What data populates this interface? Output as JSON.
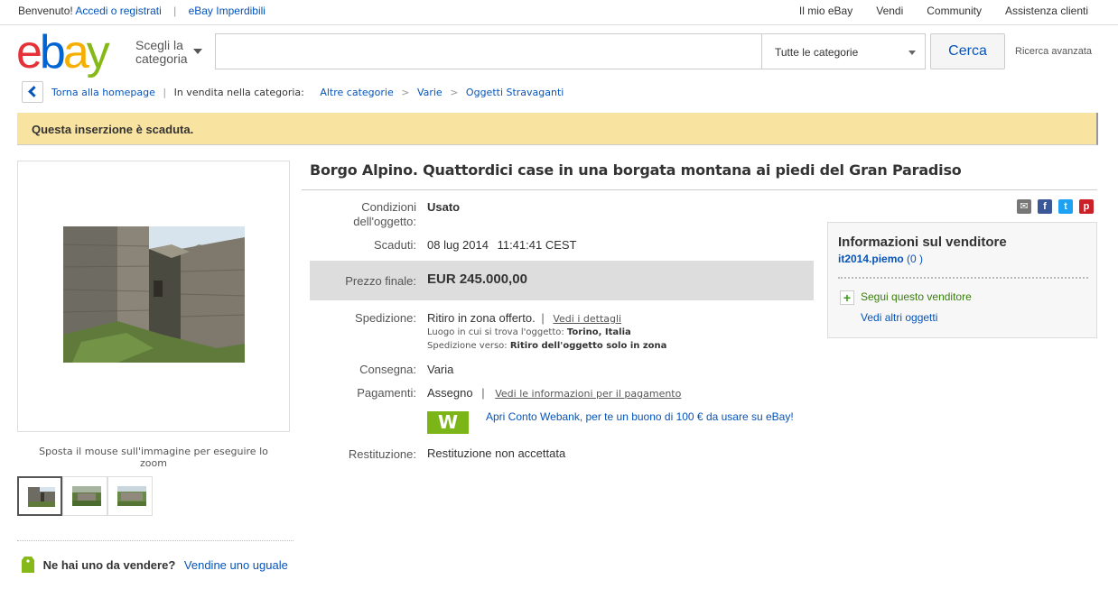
{
  "topbar": {
    "welcome": "Benvenuto!",
    "signin": "Accedi o registrati",
    "deals": "eBay Imperdibili",
    "right_links": [
      "Il mio eBay",
      "Vendi",
      "Community",
      "Assistenza clienti"
    ]
  },
  "header": {
    "logo": [
      "e",
      "b",
      "a",
      "y"
    ],
    "shop_by_line1": "Scegli la",
    "shop_by_line2": "categoria",
    "search_placeholder": "",
    "category_select": "Tutte le categorie",
    "search_button": "Cerca",
    "advanced": "Ricerca avanzata"
  },
  "breadcrumb": {
    "back": "Torna alla homepage",
    "in_category": "In vendita nella categoria:",
    "path": [
      "Altre categorie",
      "Varie",
      "Oggetti Stravaganti"
    ],
    "sep": ">"
  },
  "alert": {
    "text": "Questa inserzione è scaduta."
  },
  "gallery": {
    "hover_tip": "Sposta il mouse sull'immagine per eseguire lo zoom",
    "thumb_count": 3
  },
  "sell_similar": {
    "question": "Ne hai uno da vendere?",
    "link": "Vendine uno uguale"
  },
  "item": {
    "title": "Borgo Alpino. Quattordici case in una borgata montana ai piedi del Gran Paradiso",
    "condition_label_1": "Condizioni",
    "condition_label_2": "dell'oggetto:",
    "condition": "Usato",
    "ended_label": "Scaduti:",
    "ended_date": "08 lug 2014",
    "ended_time": "11:41:41 CEST",
    "price_label": "Prezzo finale:",
    "price": "EUR 245.000,00",
    "shipping_label": "Spedizione:",
    "shipping_value": "Ritiro in zona offerto.",
    "shipping_link": "Vedi i dettagli",
    "location_label": "Luogo in cui si trova l'oggetto:",
    "location": "Torino, Italia",
    "ships_to_label": "Spedizione verso:",
    "ships_to": "Ritiro dell'oggetto solo in zona",
    "delivery_label": "Consegna:",
    "delivery": "Varia",
    "payment_label": "Pagamenti:",
    "payment": "Assegno",
    "payment_link": "Vedi le informazioni per il pagamento",
    "webank_logo": "W",
    "webank_text": "Apri Conto Webank, per te un buono di 100 € da usare su eBay!",
    "returns_label": "Restituzione:",
    "returns": "Restituzione non accettata"
  },
  "share": {
    "icons": [
      "email-icon",
      "facebook-icon",
      "twitter-icon",
      "pinterest-icon"
    ],
    "glyphs": [
      "✉",
      "f",
      "t",
      "p"
    ]
  },
  "seller": {
    "heading": "Informazioni sul venditore",
    "name": "it2014.piemo",
    "feedback": "(0 )",
    "follow": "Segui questo venditore",
    "more": "Vedi altri oggetti"
  },
  "colors": {
    "link": "#0654ba",
    "alert_bg": "#f9e3a0",
    "price_band": "#dddddd",
    "webank": "#7cb518"
  }
}
